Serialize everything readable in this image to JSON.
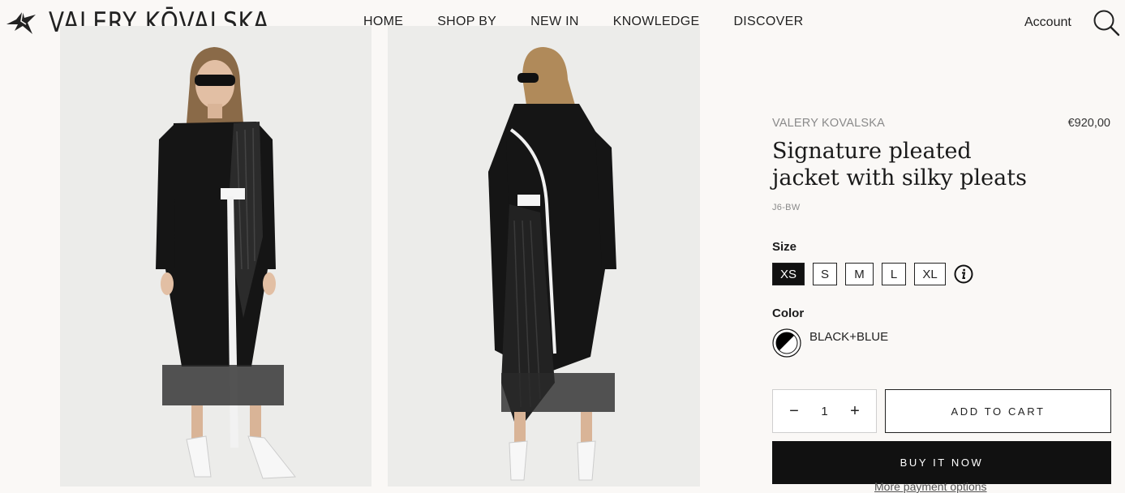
{
  "header": {
    "logo_text": "VALERY KŌVALSKA",
    "nav": [
      "HOME",
      "SHOP BY",
      "NEW IN",
      "KNOWLEDGE",
      "DISCOVER"
    ],
    "account_label": "Account",
    "search_icon": "search-icon",
    "logo_icon": "swallow-bird-icon"
  },
  "product": {
    "brand": "VALERY KOVALSKA",
    "price": "€920,00",
    "title": "Signature pleated jacket with silky pleats",
    "sku": "J6-BW",
    "size_label": "Size",
    "sizes": [
      "XS",
      "S",
      "M",
      "L",
      "XL"
    ],
    "selected_size": "XS",
    "size_info_icon": "info-icon",
    "color_label": "Color",
    "color_name": "BLACK+BLUE",
    "swatch_colors": [
      "#000000",
      "#ffffff"
    ],
    "quantity": "1",
    "add_to_cart_label": "ADD TO CART",
    "buy_now_label": "BUY IT NOW",
    "more_payment_label": "More payment options"
  },
  "colors": {
    "background": "#faf8f6",
    "button_dark": "#111111",
    "photo_bg": "#ececea"
  }
}
